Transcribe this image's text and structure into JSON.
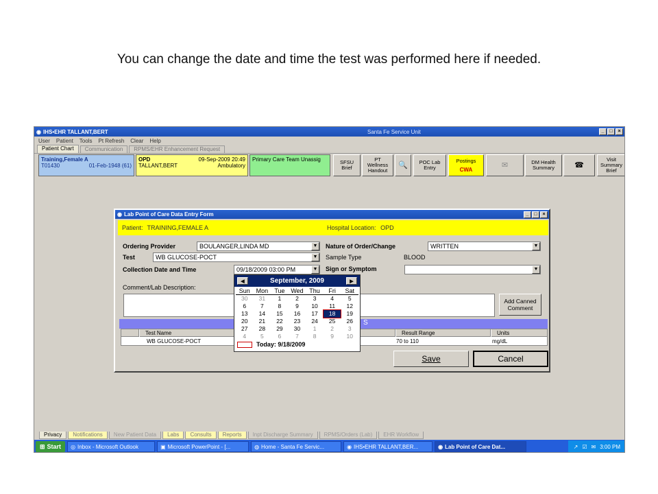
{
  "caption": "You can change the date and time the test was performed here if needed.",
  "ehr": {
    "title": "IHS•EHR  TALLANT,BERT",
    "center_title": "Santa Fe Service Unit",
    "menu": [
      "User",
      "Patient",
      "Tools",
      "Pt Refresh",
      "Clear",
      "Help"
    ],
    "tabs": [
      "Patient Chart",
      "Communication",
      "RPMS/EHR Enhancement Request"
    ],
    "patient": {
      "name": "Training,Female A",
      "id": "T01430",
      "dob": "01-Feb-1948 (61)"
    },
    "visit": {
      "location": "OPD",
      "datetime": "09-Sep-2009 20:49",
      "provider": "TALLANT,BERT",
      "type": "Ambulatory"
    },
    "team": "Primary Care Team Unassig",
    "toolbar": {
      "sfsu": "SFSU Brief",
      "pt_wellness": "PT Wellness Handout",
      "poc": "POC Lab Entry",
      "postings": "Postings",
      "cwa": "CWA",
      "dm_health": "DM Health Summary",
      "visit_summary": "Visit Summary Brief"
    },
    "bottom_tabs": [
      "Privacy",
      "Notifications",
      "New Patient Data",
      "Labs",
      "Consults",
      "Reports",
      "Inpt Discharge Summary",
      "RPMS/Orders (Lab)",
      "EHR Workflow"
    ]
  },
  "taskbar": {
    "start": "Start",
    "tasks": [
      "Inbox - Microsoft Outlook",
      "Microsoft PowerPoint - [...",
      "Home - Santa Fe Servic...",
      "IHS•EHR  TALLANT,BER...",
      "Lab Point of Care Dat..."
    ],
    "time": "3:00 PM"
  },
  "lab_form": {
    "title": "Lab Point of Care Data Entry Form",
    "patient_label": "Patient:",
    "patient_value": "TRAINING,FEMALE A",
    "hospital_label": "Hospital Location:",
    "hospital_value": "OPD",
    "ordering_provider_label": "Ordering Provider",
    "ordering_provider_value": "BOULANGER,LINDA MD",
    "test_label": "Test",
    "test_value": "WB GLUCOSE-POCT",
    "collection_label": "Collection Date and Time",
    "collection_value": "09/18/2009 03:00 PM",
    "nature_label": "Nature of Order/Change",
    "nature_value": "WRITTEN",
    "sample_type_label": "Sample Type",
    "sample_type_value": "BLOOD",
    "sign_label": "Sign or Symptom",
    "sign_value": "",
    "comment_label": "Comment/Lab Description:",
    "add_canned_label": "Add Canned Comment",
    "band_fragment": "S",
    "grid_headers": [
      "Test Name",
      "Result Range",
      "Units"
    ],
    "grid_row": [
      "WB GLUCOSE-POCT",
      "70 to 110",
      "mg/dL"
    ],
    "save_label": "Save",
    "cancel_label": "Cancel"
  },
  "calendar": {
    "month_label": "September, 2009",
    "dow": [
      "Sun",
      "Mon",
      "Tue",
      "Wed",
      "Thu",
      "Fri",
      "Sat"
    ],
    "days": [
      [
        "30",
        "31",
        "1",
        "2",
        "3",
        "4",
        "5"
      ],
      [
        "6",
        "7",
        "8",
        "9",
        "10",
        "11",
        "12"
      ],
      [
        "13",
        "14",
        "15",
        "16",
        "17",
        "18",
        "19"
      ],
      [
        "20",
        "21",
        "22",
        "23",
        "24",
        "25",
        "26"
      ],
      [
        "27",
        "28",
        "29",
        "30",
        "1",
        "2",
        "3"
      ],
      [
        "4",
        "5",
        "6",
        "7",
        "8",
        "9",
        "10"
      ]
    ],
    "selected": "18",
    "today_label": "Today: 9/18/2009"
  }
}
